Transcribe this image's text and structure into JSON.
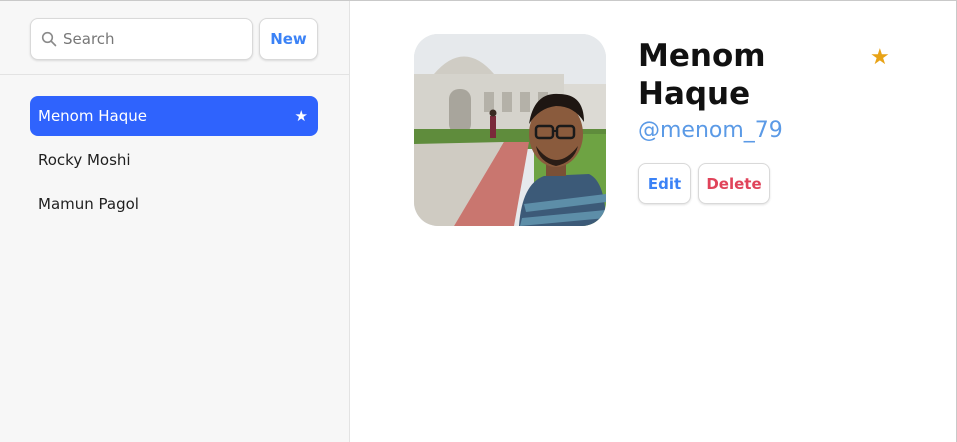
{
  "sidebar": {
    "search": {
      "placeholder": "Search",
      "value": ""
    },
    "new_label": "New",
    "contacts": [
      {
        "name": "Menom Haque",
        "favorite": "★",
        "active": true
      },
      {
        "name": "Rocky Moshi"
      },
      {
        "name": "Mamun Pagol"
      }
    ]
  },
  "detail": {
    "name": "Menom Haque",
    "favorite_star": "★",
    "handle": "@menom_79",
    "edit_label": "Edit",
    "delete_label": "Delete"
  },
  "colors": {
    "accent": "#2f63fd",
    "link": "#3b82f6",
    "star": "#e8a317",
    "danger": "#e0435a"
  },
  "icons": {
    "search": "search-icon",
    "favorite": "star-icon"
  }
}
